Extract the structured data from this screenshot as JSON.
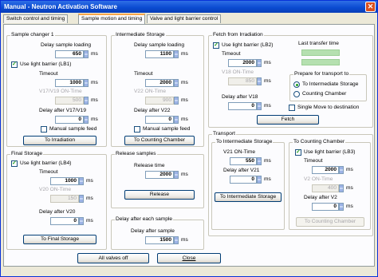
{
  "window": {
    "title": "Manual - Neutron Activation Software",
    "close_glyph": "✕"
  },
  "tabs": [
    "Switch control and timing",
    "Sample motion and timing",
    "Valve and light barrier control"
  ],
  "units": "ms",
  "check_mark": "✓",
  "sample_changer": {
    "label": "Sample changer 1",
    "delay_loading_label": "Delay sample loading",
    "delay_loading": "650",
    "use_lb_label": "Use light barrier (LB1)",
    "timeout_label": "Timeout",
    "timeout": "1000",
    "on_time_label": "V17/V19 ON-Time",
    "on_time": "500",
    "delay_after_label": "Delay after V17/V19",
    "delay_after": "0",
    "manual_feed_label": "Manual sample feed",
    "to_irradiation": "To Irradiation"
  },
  "intermediate": {
    "label": "Intermediate Storage",
    "delay_loading_label": "Delay sample loading",
    "delay_loading": "1100",
    "timeout_label": "Timeout",
    "timeout": "2000",
    "on_time_label": "V22 ON-Time",
    "on_time": "900",
    "delay_after_label": "Delay after V22",
    "delay_after": "0",
    "manual_feed_label": "Manual sample feed",
    "to_counting": "To Counting Chamber"
  },
  "fetch": {
    "label": "Fetch from Irradiation",
    "use_lb_label": "Use light barrier (LB2)",
    "timeout_label": "Timeout",
    "timeout": "2000",
    "on_time_label": "V18 ON-Time",
    "on_time": "850",
    "delay_after_label": "Delay after V18",
    "delay_after": "0",
    "fetch_btn": "Fetch",
    "last_transfer_label": "Last transfer time",
    "prepare_label": "Prepare for transport to",
    "opt_intermediate": "To Intermediate Storage",
    "opt_counting": "Counting Chamber",
    "single_move": "Single Move to destination"
  },
  "final_storage": {
    "label": "Final Storage",
    "use_lb_label": "Use light barrier (LB4)",
    "timeout_label": "Timeout",
    "timeout": "1000",
    "on_time_label": "V20 ON-Time",
    "on_time": "150",
    "delay_after_label": "Delay after V20",
    "delay_after": "0",
    "btn": "To Final Storage"
  },
  "release": {
    "label": "Release samples",
    "time_label": "Release time",
    "time": "2000",
    "btn": "Release"
  },
  "delay_each": {
    "label": "Delay after each sample",
    "after_label": "Delay after sample",
    "after": "1500"
  },
  "transport": {
    "label": "Transport",
    "to_int_label": "To Intermediate Storage",
    "v21_label": "V21 ON-Time",
    "v21": "550",
    "v21_delay_label": "Delay after V21",
    "v21_delay": "0",
    "to_int_btn": "To Intermediate Storage",
    "to_cc_label": "To Counting Chamber",
    "use_lb_label": "Use light barrier (LB3)",
    "timeout_label": "Timeout",
    "timeout": "2000",
    "v2_on_label": "V2 ON-Time",
    "v2_on": "400",
    "v2_delay_label": "Delay after V2",
    "v2_delay": "0",
    "to_cc_btn": "To Counting Chamber"
  },
  "footer": {
    "all_valves_off": "All valves off",
    "close": "Close"
  }
}
